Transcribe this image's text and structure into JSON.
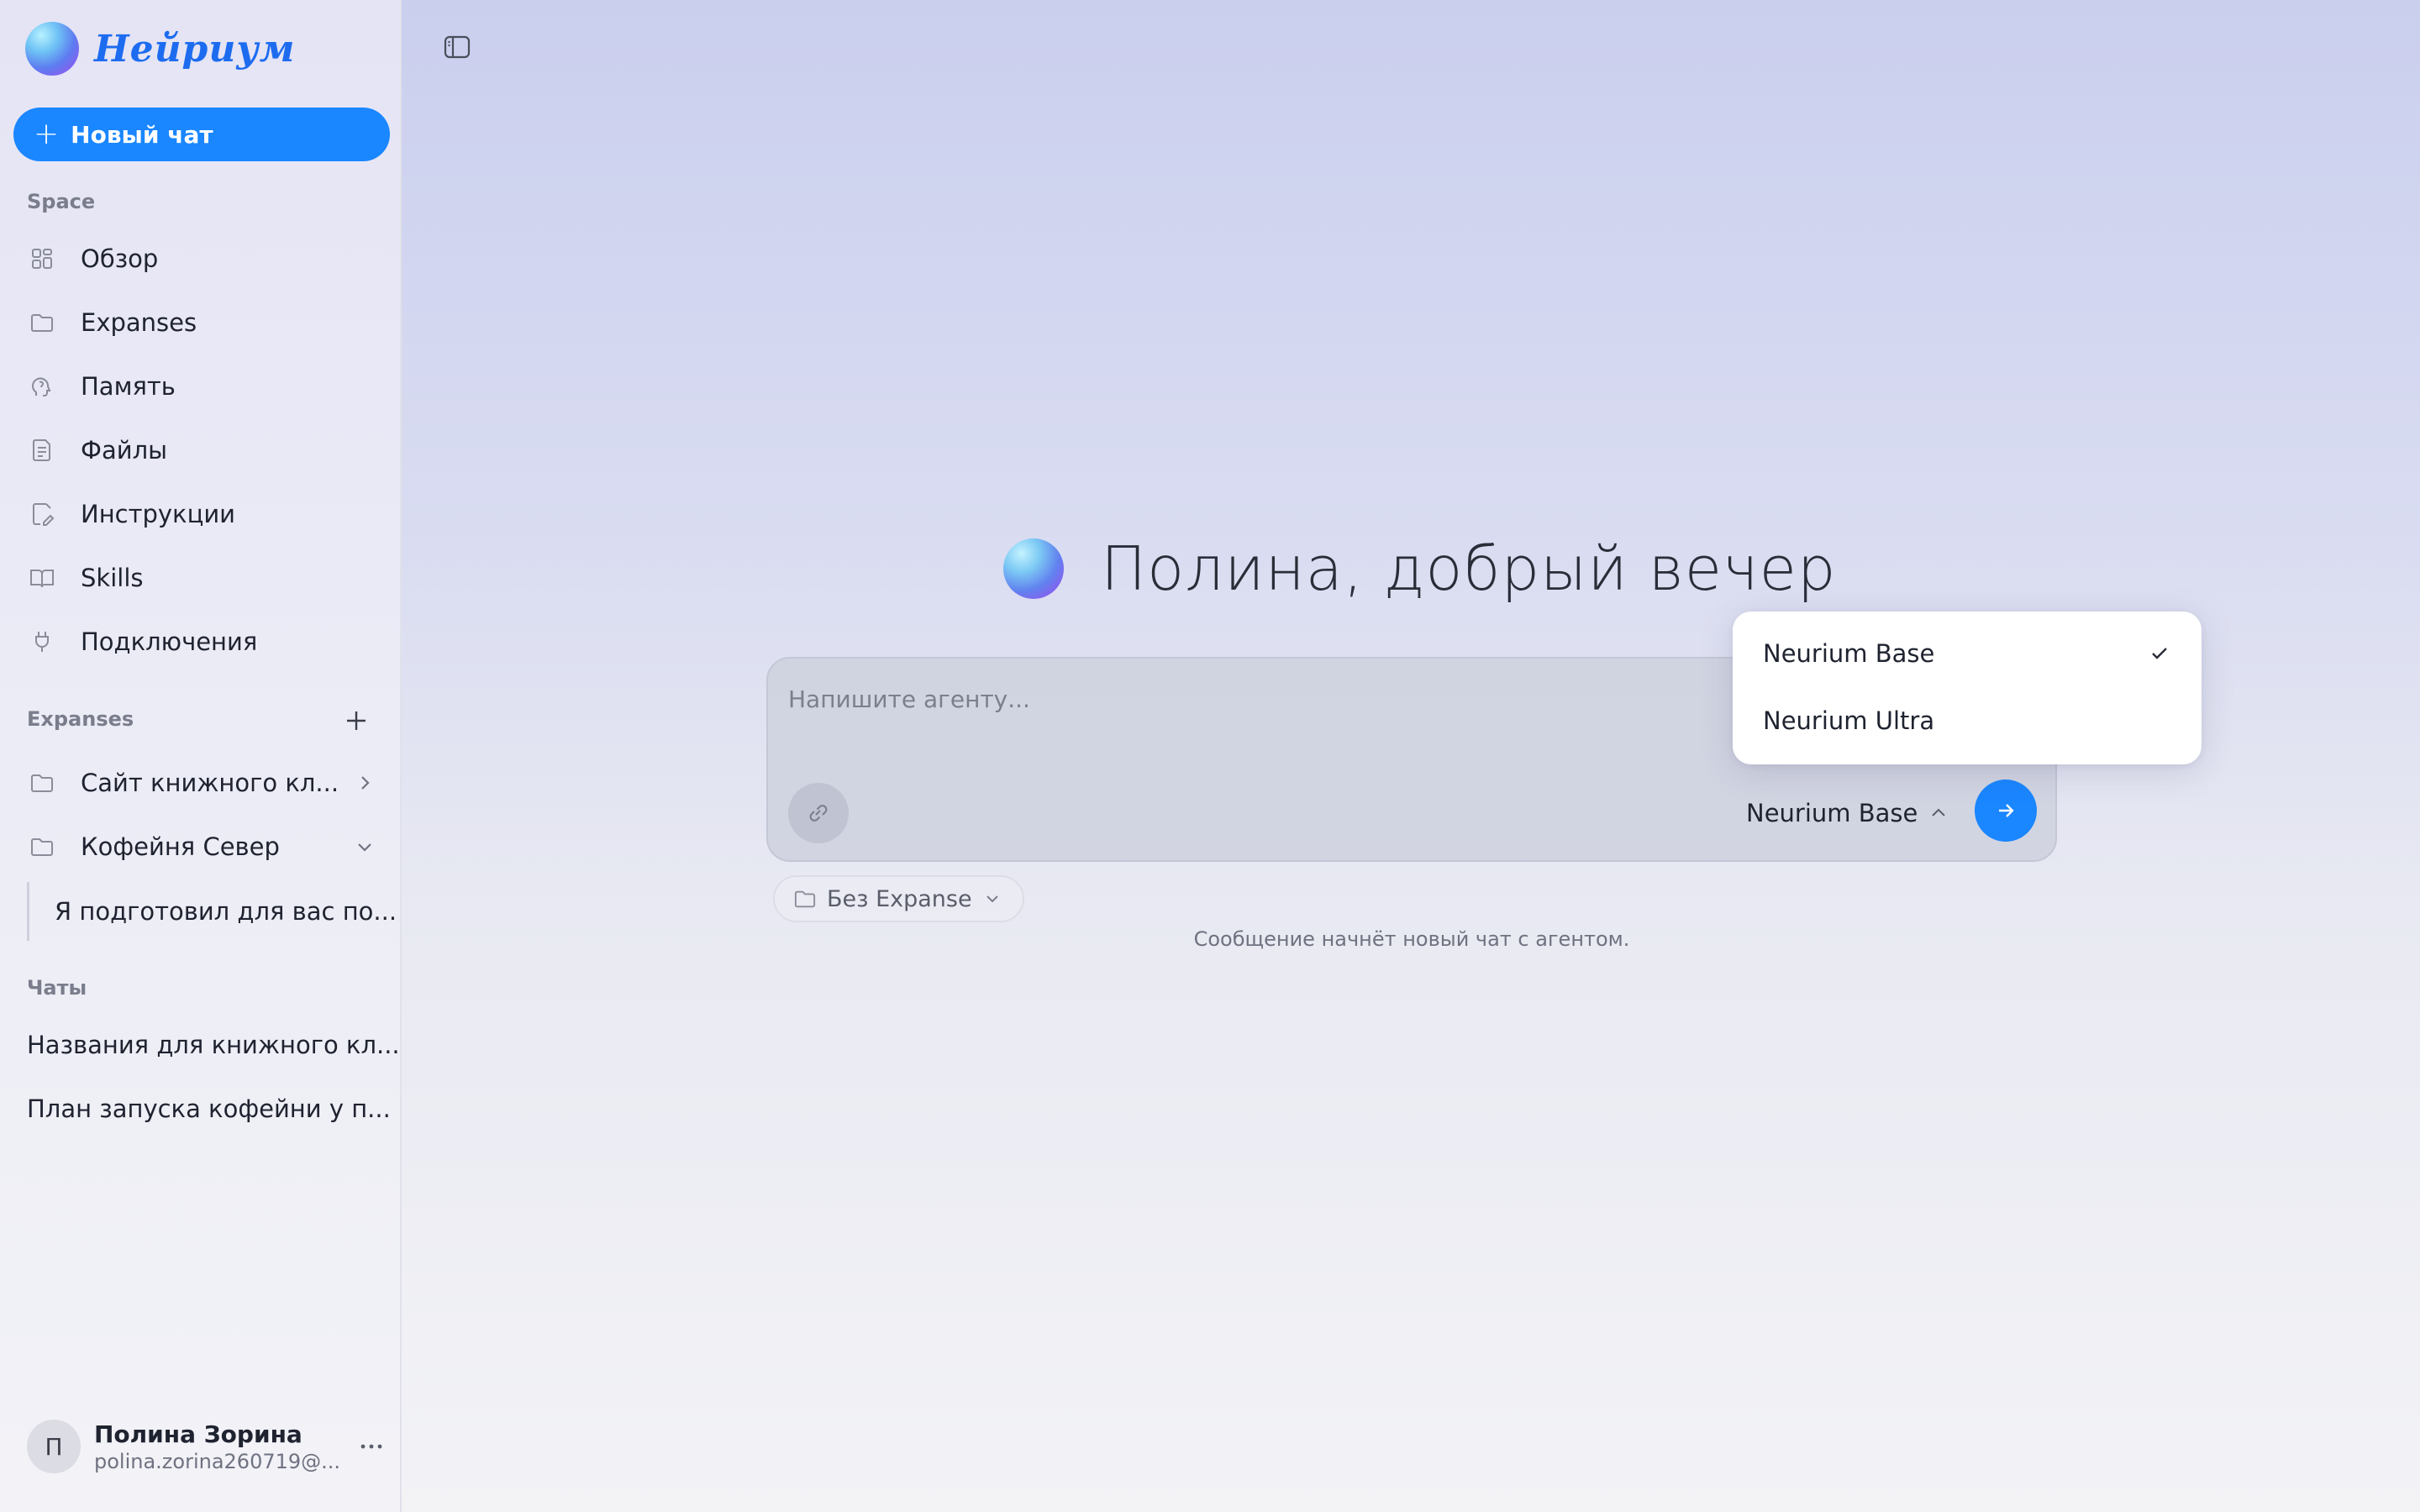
{
  "brand": {
    "name": "Нейриум"
  },
  "sidebar": {
    "new_chat_label": "Новый чат",
    "space_label": "Space",
    "nav": [
      {
        "label": "Обзор",
        "icon": "grid-icon"
      },
      {
        "label": "Expanses",
        "icon": "folder-icon"
      },
      {
        "label": "Память",
        "icon": "brain-icon"
      },
      {
        "label": "Файлы",
        "icon": "file-icon"
      },
      {
        "label": "Инструкции",
        "icon": "edit-doc-icon"
      },
      {
        "label": "Skills",
        "icon": "book-icon"
      },
      {
        "label": "Подключения",
        "icon": "plug-icon"
      }
    ],
    "expanses_label": "Expanses",
    "expanses": [
      {
        "label": "Сайт книжного кл...",
        "chevron": "right"
      },
      {
        "label": "Кофейня Север",
        "chevron": "down"
      }
    ],
    "sub_thread": "Я подготовил для вас по...",
    "chats_label": "Чаты",
    "chats": [
      {
        "label": "Названия для книжного кл..."
      },
      {
        "label": "План запуска кофейни у п..."
      }
    ],
    "user": {
      "initial": "П",
      "name": "Полина Зорина",
      "email": "polina.zorina260719@..."
    }
  },
  "main": {
    "greeting": "Полина, добрый вечер",
    "composer": {
      "placeholder": "Напишите агенту...",
      "model_label": "Neurium Base"
    },
    "expanse_chip": "Без Expanse",
    "hint": "Сообщение начнёт новый чат с агентом."
  },
  "model_dropdown": {
    "items": [
      {
        "label": "Neurium Base",
        "selected": true
      },
      {
        "label": "Neurium Ultra",
        "selected": false
      }
    ]
  },
  "colors": {
    "accent": "#1a86ff",
    "brand_text": "#1d6cf0"
  }
}
